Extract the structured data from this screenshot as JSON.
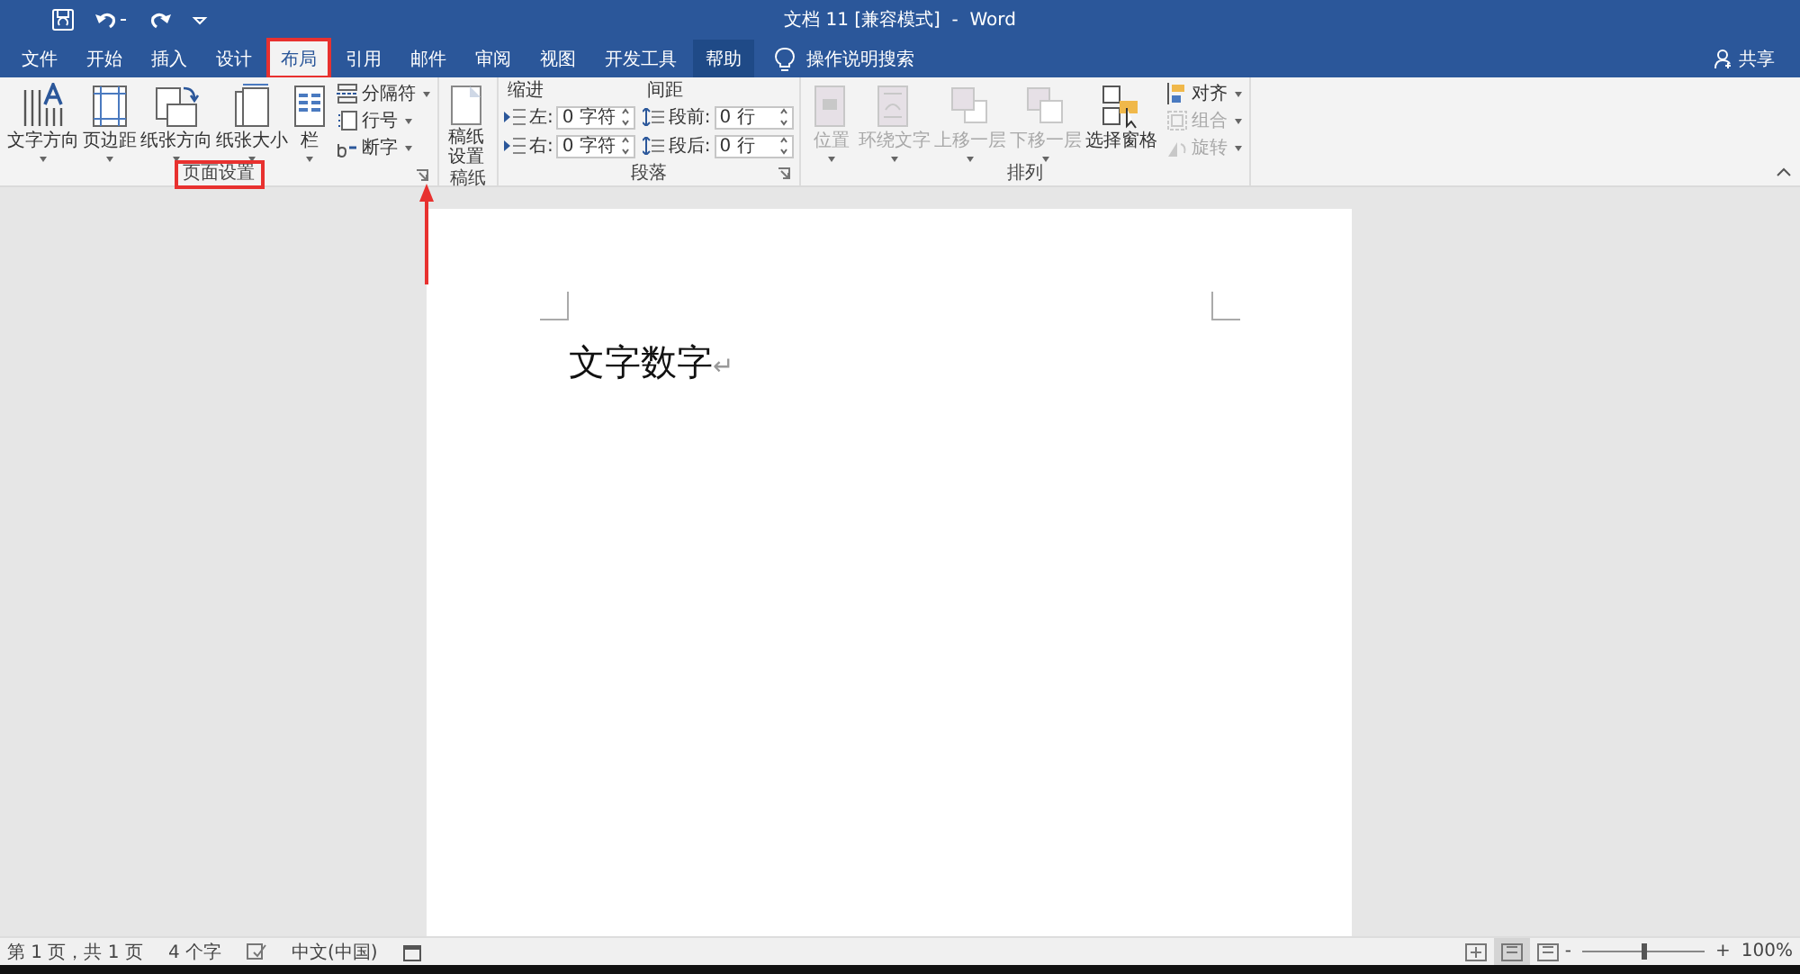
{
  "title_bar": {
    "title": "文档 11 [兼容模式]  -  Word"
  },
  "tabs": [
    {
      "label": "文件",
      "selected": false,
      "highlighted": false,
      "annotated": false
    },
    {
      "label": "开始",
      "selected": false,
      "highlighted": false,
      "annotated": false
    },
    {
      "label": "插入",
      "selected": false,
      "highlighted": false,
      "annotated": false
    },
    {
      "label": "设计",
      "selected": false,
      "highlighted": false,
      "annotated": false
    },
    {
      "label": "布局",
      "selected": true,
      "highlighted": false,
      "annotated": true
    },
    {
      "label": "引用",
      "selected": false,
      "highlighted": false,
      "annotated": false
    },
    {
      "label": "邮件",
      "selected": false,
      "highlighted": false,
      "annotated": false
    },
    {
      "label": "审阅",
      "selected": false,
      "highlighted": false,
      "annotated": false
    },
    {
      "label": "视图",
      "selected": false,
      "highlighted": false,
      "annotated": false
    },
    {
      "label": "开发工具",
      "selected": false,
      "highlighted": false,
      "annotated": false
    },
    {
      "label": "帮助",
      "selected": false,
      "highlighted": true,
      "annotated": false
    }
  ],
  "tell_me": {
    "placeholder": "操作说明搜索"
  },
  "share": {
    "label": "共享"
  },
  "page_setup": {
    "label": "页面设置",
    "label_annotated": true,
    "launcher_annotated": true,
    "big_buttons": [
      {
        "label": "文字方向"
      },
      {
        "label": "页边距"
      },
      {
        "label": "纸张方向"
      },
      {
        "label": "纸张大小"
      },
      {
        "label": "栏"
      }
    ],
    "small_buttons": [
      {
        "label": "分隔符"
      },
      {
        "label": "行号"
      },
      {
        "label": "断字"
      }
    ]
  },
  "manuscript": {
    "label": "稿纸",
    "button_lines": [
      "稿纸",
      "设置"
    ]
  },
  "paragraph": {
    "label": "段落",
    "indent_heading": "缩进",
    "spacing_heading": "间距",
    "indent": [
      {
        "label": "左:",
        "value": "0 字符"
      },
      {
        "label": "右:",
        "value": "0 字符"
      }
    ],
    "spacing": [
      {
        "label": "段前:",
        "value": "0 行"
      },
      {
        "label": "段后:",
        "value": "0 行"
      }
    ]
  },
  "arrange": {
    "label": "排列",
    "big_buttons": [
      {
        "label": "位置",
        "disabled": true
      },
      {
        "label": "环绕文字",
        "disabled": true
      },
      {
        "label": "上移一层",
        "disabled": true
      },
      {
        "label": "下移一层",
        "disabled": true
      },
      {
        "label": "选择窗格",
        "disabled": false
      }
    ],
    "small_buttons": [
      {
        "label": "对齐",
        "disabled": false
      },
      {
        "label": "组合",
        "disabled": true
      },
      {
        "label": "旋转",
        "disabled": true
      }
    ]
  },
  "document": {
    "text": "文字数字",
    "paragraph_mark": "↵"
  },
  "status_bar": {
    "page": "第 1 页，共 1 页",
    "words": "4 个字",
    "language": "中文(中国)",
    "views": [
      {
        "selected": false
      },
      {
        "selected": true
      },
      {
        "selected": false
      }
    ],
    "zoom": {
      "level": 0.5,
      "minus": "-",
      "plus": "+",
      "reading": "100%"
    }
  }
}
